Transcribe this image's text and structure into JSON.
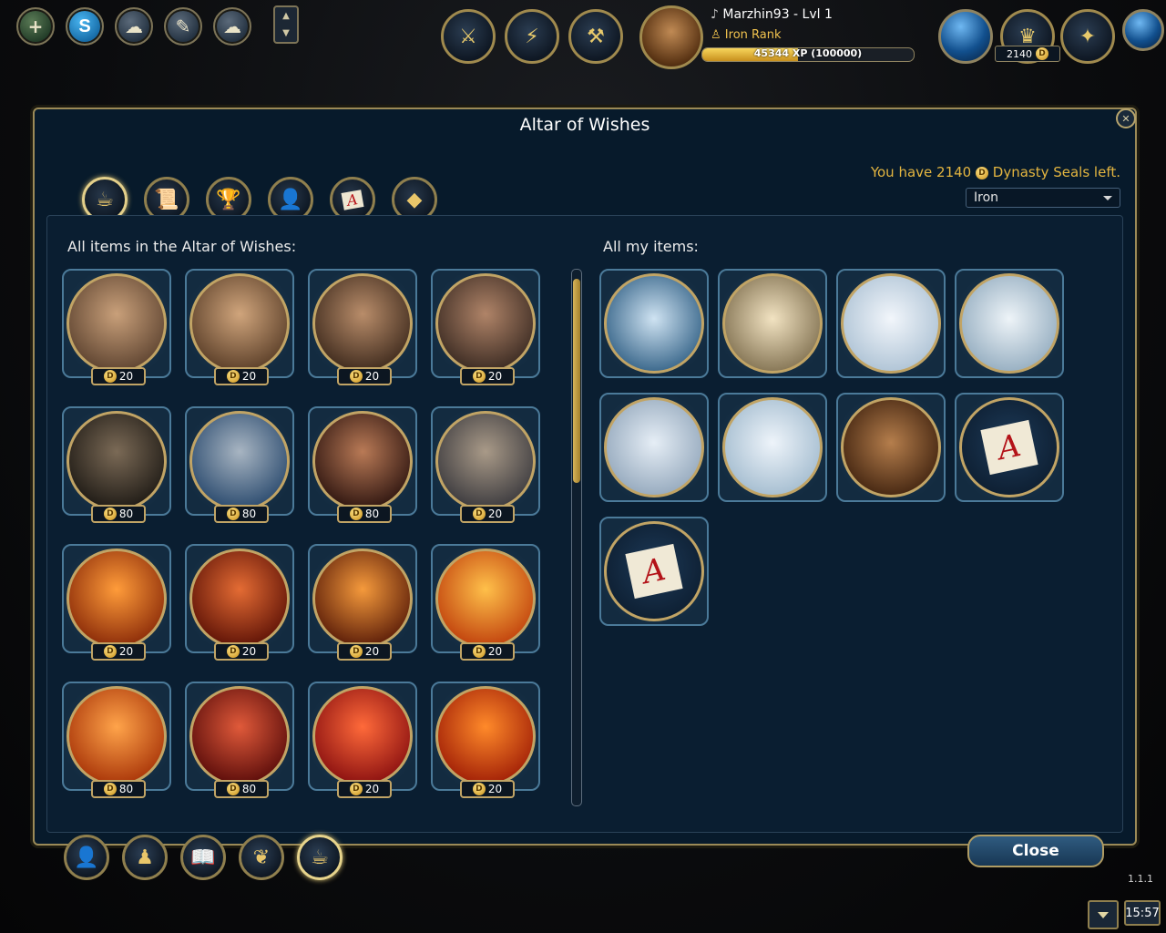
{
  "top_left_buttons": [
    {
      "name": "add-friend-button",
      "icon": "plus-icon",
      "glyph": "+"
    },
    {
      "name": "skype-button",
      "icon": "skype-icon",
      "glyph": "S"
    },
    {
      "name": "chat-button",
      "icon": "chat-icon",
      "glyph": "☁"
    },
    {
      "name": "whisper-button",
      "icon": "whisper-icon",
      "glyph": "✎"
    },
    {
      "name": "group-chat-button",
      "icon": "group-chat-icon",
      "glyph": "☁"
    }
  ],
  "hud_buttons": [
    {
      "name": "army-button",
      "icon": "helmet-icon",
      "glyph": "⚔"
    },
    {
      "name": "skills-button",
      "icon": "lightning-icon",
      "glyph": "⚡"
    },
    {
      "name": "battle-button",
      "icon": "crossed-weapons-icon",
      "glyph": "⚒"
    }
  ],
  "player": {
    "name": "Marzhin93 - Lvl 1",
    "rank": "Iron Rank",
    "xp_text": "45344 XP (100000)",
    "xp_progress": 0.45344
  },
  "currency": {
    "amount": "2140"
  },
  "window": {
    "title": "Altar of Wishes",
    "seals_prefix": "You have 2140",
    "seals_suffix": "Dynasty Seals left.",
    "rank_select": "Iron",
    "altar_label": "All items in the Altar of Wishes:",
    "my_items_label": "All my items:",
    "close_label": "Close"
  },
  "tabs": [
    {
      "name": "tab-altar",
      "icon": "altar-icon",
      "glyph": "☕"
    },
    {
      "name": "tab-scrolls",
      "icon": "scroll-icon",
      "glyph": "📜"
    },
    {
      "name": "tab-grail",
      "icon": "grail-icon",
      "glyph": "🏆"
    },
    {
      "name": "tab-portraits",
      "icon": "portrait-card-icon",
      "glyph": "👤"
    },
    {
      "name": "tab-letters",
      "icon": "letter-card-icon",
      "glyph": "A"
    },
    {
      "name": "tab-other",
      "icon": "misc-icon",
      "glyph": "◆"
    }
  ],
  "altar_items": [
    {
      "price": "20",
      "colors": [
        "#c9a07a",
        "#5d4330"
      ]
    },
    {
      "price": "20",
      "colors": [
        "#d0a57c",
        "#5a3e28"
      ]
    },
    {
      "price": "20",
      "colors": [
        "#b98d6a",
        "#3e2a1d"
      ]
    },
    {
      "price": "20",
      "colors": [
        "#b08468",
        "#3a2a22"
      ]
    },
    {
      "price": "80",
      "colors": [
        "#7b6a56",
        "#1e1a15"
      ]
    },
    {
      "price": "80",
      "colors": [
        "#a8b5c2",
        "#2a4a6e"
      ]
    },
    {
      "price": "80",
      "colors": [
        "#b97a56",
        "#2e1510"
      ]
    },
    {
      "price": "20",
      "colors": [
        "#a99a88",
        "#3b3a3e"
      ]
    },
    {
      "price": "20",
      "colors": [
        "#ff9c3a",
        "#8a2a08"
      ]
    },
    {
      "price": "20",
      "colors": [
        "#e46c34",
        "#5e1206"
      ]
    },
    {
      "price": "20",
      "colors": [
        "#f59a3c",
        "#5a1c08"
      ]
    },
    {
      "price": "20",
      "colors": [
        "#ffc04a",
        "#c0400c"
      ]
    },
    {
      "price": "80",
      "colors": [
        "#ffa44a",
        "#a83408"
      ]
    },
    {
      "price": "80",
      "colors": [
        "#e05a3a",
        "#5a0c0a"
      ]
    },
    {
      "price": "20",
      "colors": [
        "#ff6a3a",
        "#8a1010"
      ]
    },
    {
      "price": "20",
      "colors": [
        "#ff8a2a",
        "#a01e06"
      ]
    }
  ],
  "my_items": [
    {
      "icon": "fortress-gate-icon",
      "colors": [
        "#cfe3f2",
        "#2a5a80"
      ]
    },
    {
      "icon": "bell-shovel-icon",
      "colors": [
        "#f2e3c2",
        "#7a6a4a"
      ]
    },
    {
      "icon": "spiral-star-icon",
      "colors": [
        "#f2f6fb",
        "#a9bfd2"
      ]
    },
    {
      "icon": "spike-ball-icon",
      "colors": [
        "#eef4f8",
        "#8ea8bc"
      ]
    },
    {
      "icon": "winged-boot-icon",
      "colors": [
        "#e6eef6",
        "#8ea3b8"
      ]
    },
    {
      "icon": "gold-coins-icon",
      "colors": [
        "#eef4fa",
        "#9eb8cc"
      ]
    },
    {
      "icon": "warrior-portrait-icon",
      "colors": [
        "#b57e4c",
        "#3a1e0c"
      ]
    },
    {
      "icon": "letter-card-icon",
      "colors": [
        "#1d3a58",
        "#0c1c2e"
      ]
    },
    {
      "icon": "letter-card-icon",
      "colors": [
        "#1d3a58",
        "#0c1c2e"
      ]
    }
  ],
  "bottom_buttons": [
    {
      "name": "hero-button",
      "icon": "hero-silhouette-icon",
      "glyph": "👤"
    },
    {
      "name": "army-setup-button",
      "icon": "units-icon",
      "glyph": "♟"
    },
    {
      "name": "spellbook-button",
      "icon": "book-icon",
      "glyph": "📖"
    },
    {
      "name": "achievements-button",
      "icon": "laurel-icon",
      "glyph": "❦"
    },
    {
      "name": "altar-button",
      "icon": "altar-icon",
      "glyph": "☕"
    }
  ],
  "footer": {
    "version": "1.1.1",
    "clock": "15:57"
  }
}
